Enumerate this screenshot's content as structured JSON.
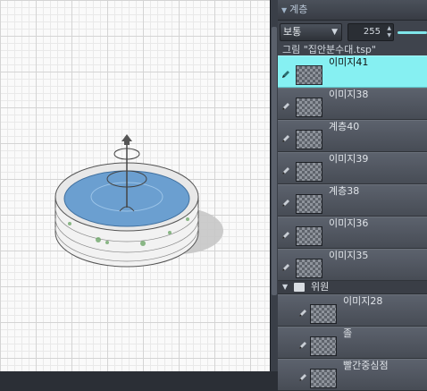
{
  "panel": {
    "title": "계층",
    "blend_mode": "보통",
    "opacity": "255",
    "file_label": "그림 \"집안분수대.tsp\""
  },
  "layers": [
    {
      "name": "이미지41",
      "selected": true
    },
    {
      "name": "이미지38"
    },
    {
      "name": "계층40"
    },
    {
      "name": "이미지39"
    },
    {
      "name": "계층38"
    },
    {
      "name": "이미지36"
    },
    {
      "name": "이미지35"
    }
  ],
  "folder": {
    "name": "위원",
    "children": [
      {
        "name": "이미지28"
      },
      {
        "name": "졸"
      },
      {
        "name": "빨간중심점"
      }
    ]
  },
  "colors": {
    "selected_row": "#86f0f2",
    "panel_bg": "#3f444d",
    "accent": "#7fe6ea"
  },
  "icons": {
    "layer_edit": "pen-icon",
    "layer_thumbnail": "transparency-checker",
    "folder": "folder-icon"
  }
}
